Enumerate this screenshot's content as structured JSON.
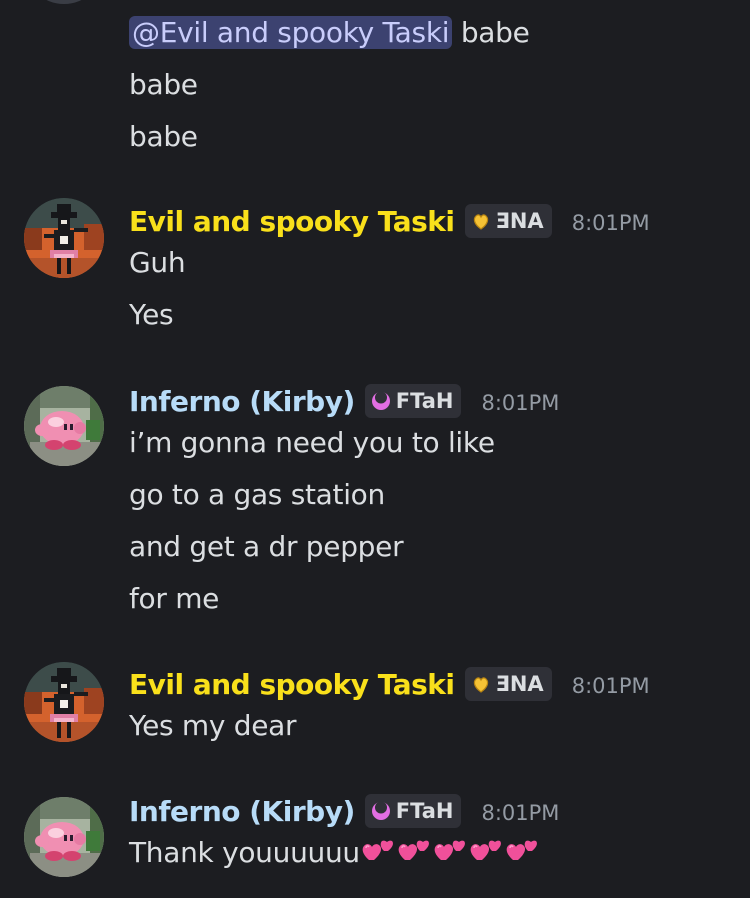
{
  "colors": {
    "background": "#1c1d21",
    "text": "#dbdee1",
    "mention_bg": "#3c4270",
    "mention_text": "#c9cdfb",
    "taski_name": "#f9e01b",
    "inferno_name": "#b8dcf8",
    "timestamp": "#949ba4",
    "tag_bg": "#2f3037"
  },
  "top_block": {
    "mention": "@Evil and spooky Taski",
    "line1_rest": " babe",
    "line2": "babe",
    "line3": "babe"
  },
  "messages": [
    {
      "author": "Evil and spooky Taski",
      "tag_icon": "gold-heart-icon",
      "tag": "ƎNA",
      "time": "8:01PM",
      "lines": [
        "Guh",
        "Yes"
      ]
    },
    {
      "author": "Inferno (Kirby)",
      "tag_icon": "crescent-moon-icon",
      "tag": "FTaH",
      "time": "8:01PM",
      "lines": [
        "i’m gonna need you to like",
        "go to a gas station",
        "and get a dr pepper",
        "for me"
      ]
    },
    {
      "author": "Evil and spooky Taski",
      "tag_icon": "gold-heart-icon",
      "tag": "ƎNA",
      "time": "8:01PM",
      "lines": [
        "Yes my dear"
      ]
    },
    {
      "author": "Inferno (Kirby)",
      "tag_icon": "crescent-moon-icon",
      "tag": "FTaH",
      "time": "8:01PM",
      "lines": [
        "Thank youuuuuu"
      ],
      "emoji": [
        "two-hearts-emoji",
        "two-hearts-emoji",
        "two-hearts-emoji",
        "two-hearts-emoji",
        "two-hearts-emoji"
      ]
    }
  ]
}
